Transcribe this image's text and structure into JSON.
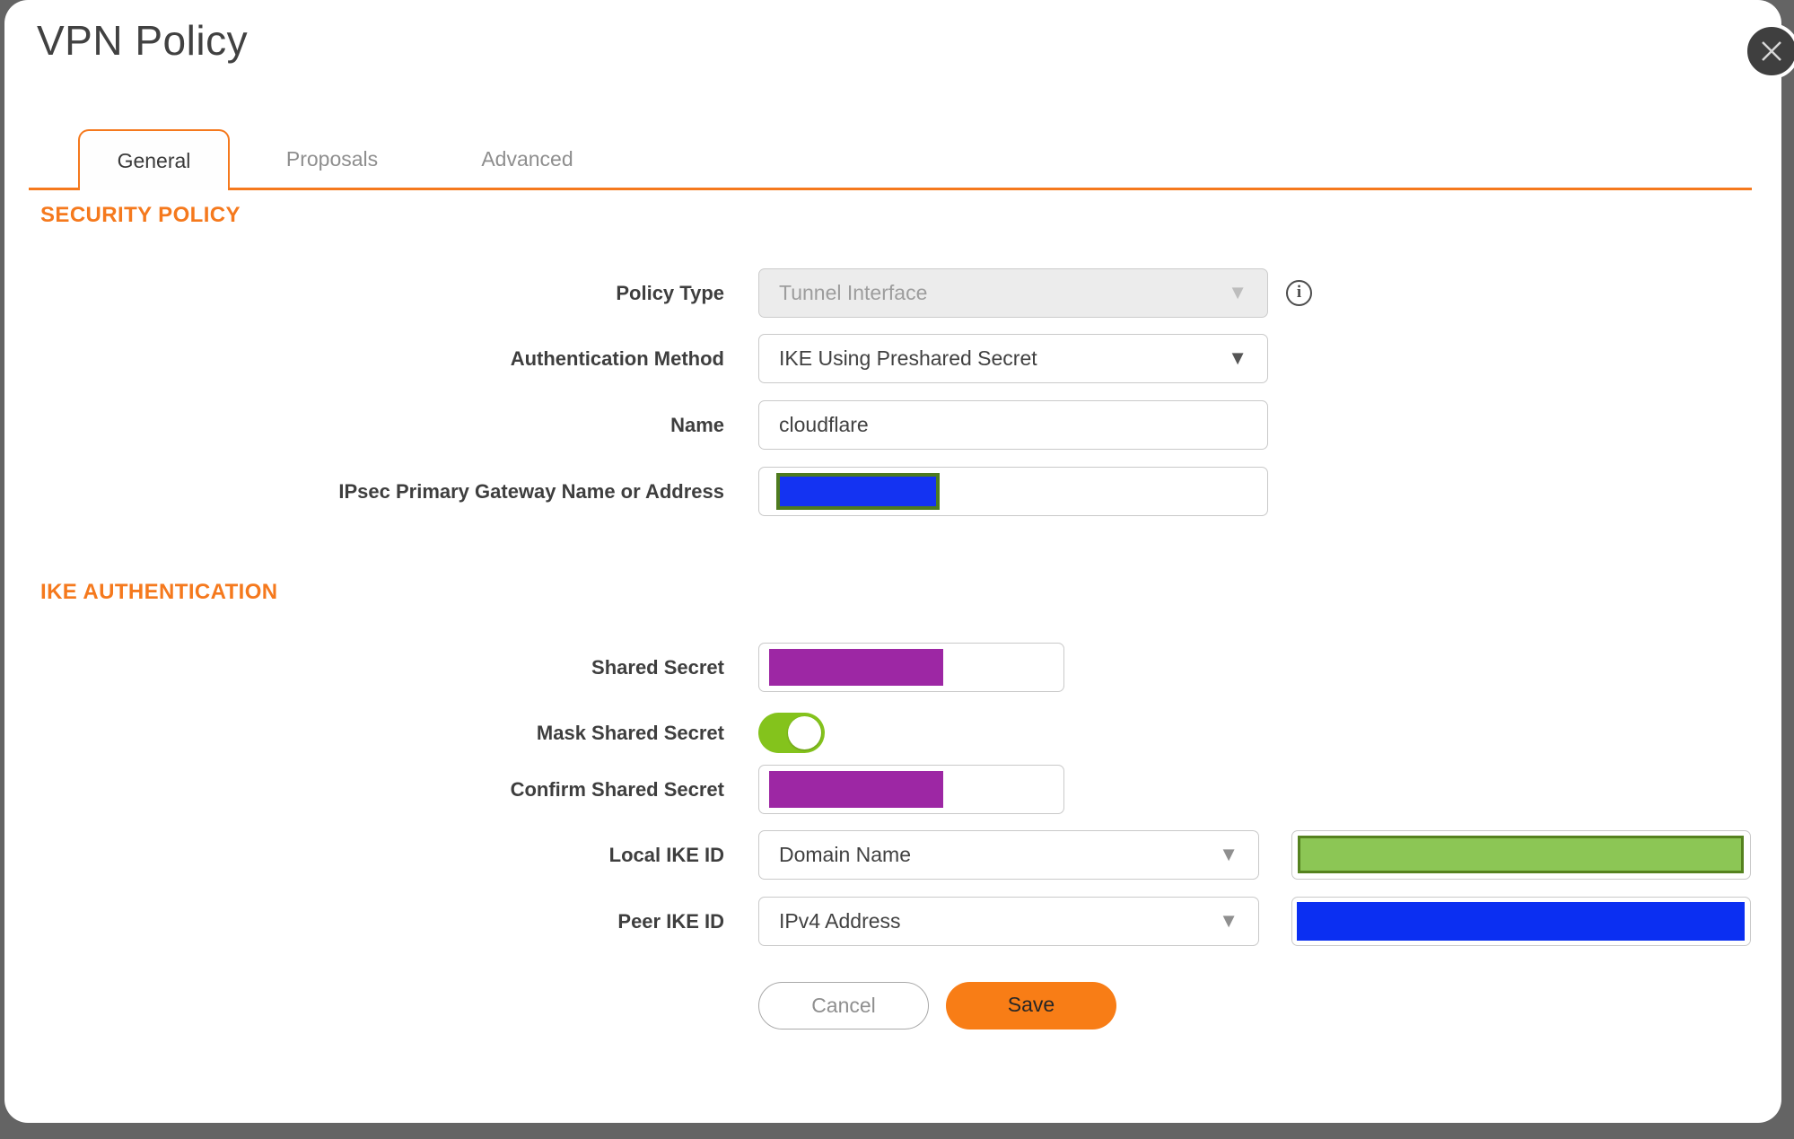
{
  "dialog": {
    "title": "VPN Policy"
  },
  "tabs": [
    {
      "label": "General",
      "active": true
    },
    {
      "label": "Proposals",
      "active": false
    },
    {
      "label": "Advanced",
      "active": false
    }
  ],
  "sections": {
    "security_policy": "SECURITY POLICY",
    "ike_authentication": "IKE AUTHENTICATION"
  },
  "fields": {
    "policy_type": {
      "label": "Policy Type",
      "value": "Tunnel Interface",
      "disabled": true
    },
    "auth_method": {
      "label": "Authentication Method",
      "value": "IKE Using Preshared Secret"
    },
    "name": {
      "label": "Name",
      "value": "cloudflare"
    },
    "gateway": {
      "label": "IPsec Primary Gateway Name or Address",
      "value": ""
    },
    "shared_secret": {
      "label": "Shared Secret",
      "value": ""
    },
    "mask_shared_secret": {
      "label": "Mask Shared Secret",
      "on": true
    },
    "confirm_shared_secret": {
      "label": "Confirm Shared Secret",
      "value": ""
    },
    "local_ike_id": {
      "label": "Local IKE ID",
      "value": "Domain Name"
    },
    "peer_ike_id": {
      "label": "Peer IKE ID",
      "value": "IPv4 Address"
    }
  },
  "buttons": {
    "cancel": "Cancel",
    "save": "Save"
  },
  "icons": {
    "caret": "▼",
    "info": "i"
  },
  "colors": {
    "accent_orange": "#f5791d",
    "save_orange": "#f87d16",
    "toggle_green": "#84c31c",
    "redact_blue": "#1433f2",
    "redact_blue_border": "#4e7b1f",
    "redact_purple": "#9d27a4",
    "redact_green": "#8cc655",
    "redact_green_border": "#55821f",
    "redact_peer_blue": "#0b2ff2"
  }
}
